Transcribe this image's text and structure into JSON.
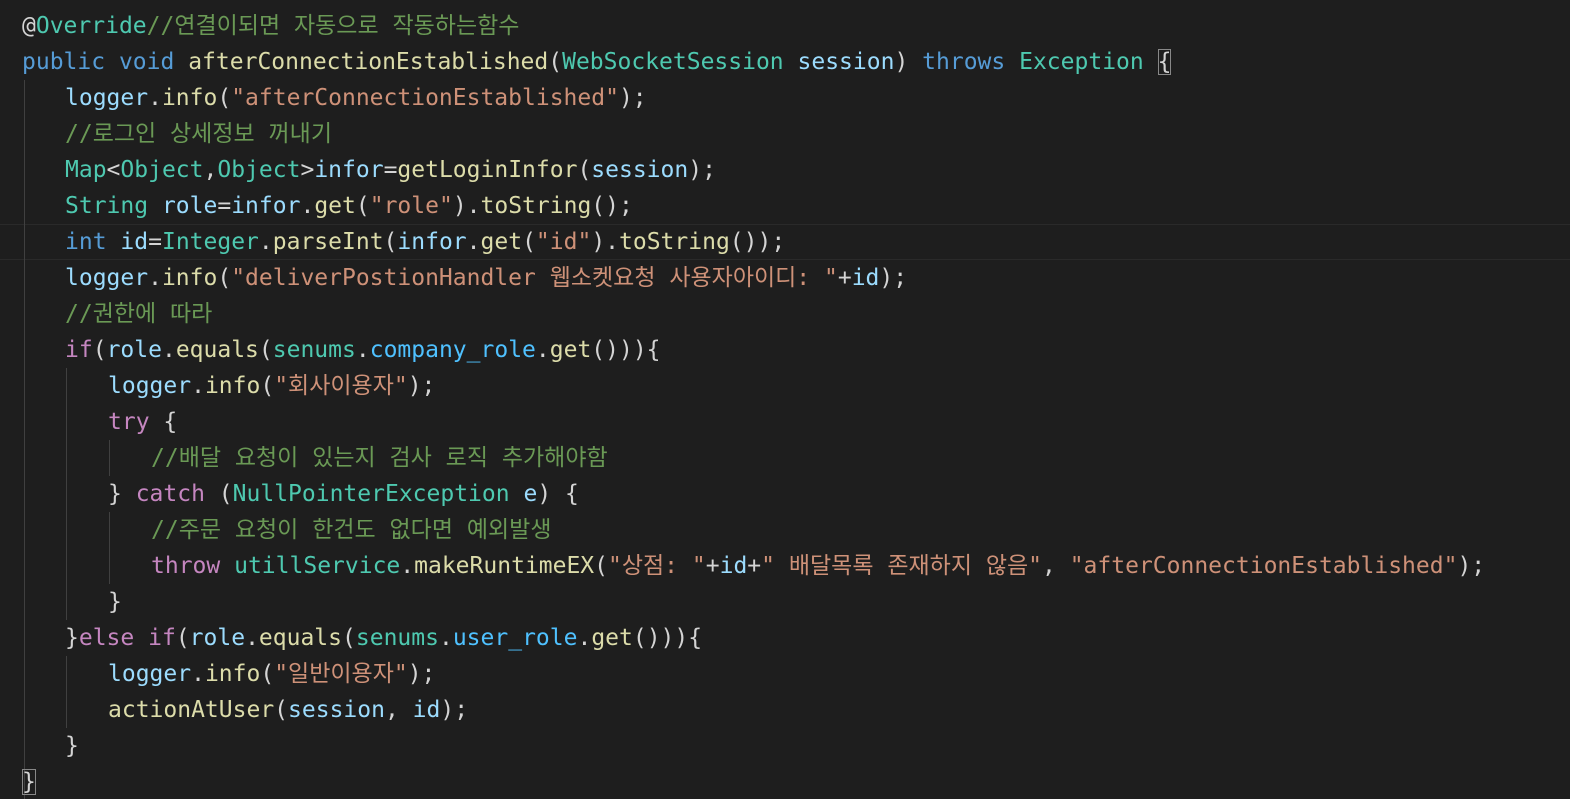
{
  "editor": {
    "language": "java",
    "theme": "dark",
    "colors": {
      "background": "#1e1e1e",
      "keyword": "#569cd6",
      "control": "#c586c0",
      "type": "#4ec9b0",
      "function": "#dcdcaa",
      "variable": "#9cdcfe",
      "string": "#ce9178",
      "comment": "#6a9955",
      "field": "#4fc1ff",
      "text": "#d4d4d4"
    },
    "lines": [
      [
        [
          "punc",
          "@"
        ],
        [
          "type",
          "Override"
        ],
        [
          "cmt",
          "//연결이되면 자동으로 작동하는함수"
        ]
      ],
      [
        [
          "kw",
          "public"
        ],
        [
          "punc",
          " "
        ],
        [
          "kw",
          "void"
        ],
        [
          "punc",
          " "
        ],
        [
          "fn",
          "afterConnectionEstablished"
        ],
        [
          "punc",
          "("
        ],
        [
          "type",
          "WebSocketSession"
        ],
        [
          "punc",
          " "
        ],
        [
          "var",
          "session"
        ],
        [
          "punc",
          ") "
        ],
        [
          "kw",
          "throws"
        ],
        [
          "punc",
          " "
        ],
        [
          "type",
          "Exception"
        ],
        [
          "punc",
          " "
        ],
        [
          "bracket",
          "{"
        ]
      ],
      [
        [
          "var",
          "logger"
        ],
        [
          "punc",
          "."
        ],
        [
          "fn",
          "info"
        ],
        [
          "punc",
          "("
        ],
        [
          "str",
          "\"afterConnectionEstablished\""
        ],
        [
          "punc",
          ");"
        ]
      ],
      [
        [
          "cmt",
          "//로그인 상세정보 꺼내기"
        ]
      ],
      [
        [
          "type",
          "Map"
        ],
        [
          "punc",
          "<"
        ],
        [
          "type",
          "Object"
        ],
        [
          "punc",
          ","
        ],
        [
          "type",
          "Object"
        ],
        [
          "punc",
          ">"
        ],
        [
          "var",
          "infor"
        ],
        [
          "punc",
          "="
        ],
        [
          "fn",
          "getLoginInfor"
        ],
        [
          "punc",
          "("
        ],
        [
          "var",
          "session"
        ],
        [
          "punc",
          ");"
        ]
      ],
      [
        [
          "type",
          "String"
        ],
        [
          "punc",
          " "
        ],
        [
          "var",
          "role"
        ],
        [
          "punc",
          "="
        ],
        [
          "var",
          "infor"
        ],
        [
          "punc",
          "."
        ],
        [
          "fn",
          "get"
        ],
        [
          "punc",
          "("
        ],
        [
          "str",
          "\"role\""
        ],
        [
          "punc",
          ")."
        ],
        [
          "fn",
          "toString"
        ],
        [
          "punc",
          "();"
        ]
      ],
      [
        [
          "kw",
          "int"
        ],
        [
          "punc",
          " "
        ],
        [
          "var",
          "id"
        ],
        [
          "punc",
          "="
        ],
        [
          "type",
          "Integer"
        ],
        [
          "punc",
          "."
        ],
        [
          "fn",
          "parseInt"
        ],
        [
          "punc",
          "("
        ],
        [
          "var",
          "infor"
        ],
        [
          "punc",
          "."
        ],
        [
          "fn",
          "get"
        ],
        [
          "punc",
          "("
        ],
        [
          "str",
          "\"id\""
        ],
        [
          "punc",
          ")."
        ],
        [
          "fn",
          "toString"
        ],
        [
          "punc",
          "());"
        ]
      ],
      [
        [
          "var",
          "logger"
        ],
        [
          "punc",
          "."
        ],
        [
          "fn",
          "info"
        ],
        [
          "punc",
          "("
        ],
        [
          "str",
          "\"deliverPostionHandler 웹소켓요청 사용자아이디: \""
        ],
        [
          "punc",
          "+"
        ],
        [
          "var",
          "id"
        ],
        [
          "punc",
          ");"
        ]
      ],
      [
        [
          "cmt",
          "//권한에 따라"
        ]
      ],
      [
        [
          "ctrl",
          "if"
        ],
        [
          "punc",
          "("
        ],
        [
          "var",
          "role"
        ],
        [
          "punc",
          "."
        ],
        [
          "fn",
          "equals"
        ],
        [
          "punc",
          "("
        ],
        [
          "type",
          "senums"
        ],
        [
          "punc",
          "."
        ],
        [
          "field",
          "company_role"
        ],
        [
          "punc",
          "."
        ],
        [
          "fn",
          "get"
        ],
        [
          "punc",
          "())){"
        ]
      ],
      [
        [
          "var",
          "logger"
        ],
        [
          "punc",
          "."
        ],
        [
          "fn",
          "info"
        ],
        [
          "punc",
          "("
        ],
        [
          "str",
          "\"회사이용자\""
        ],
        [
          "punc",
          ");"
        ]
      ],
      [
        [
          "ctrl",
          "try"
        ],
        [
          "punc",
          " {"
        ]
      ],
      [
        [
          "cmt",
          "//배달 요청이 있는지 검사 로직 추가해야함"
        ]
      ],
      [
        [
          "punc",
          "} "
        ],
        [
          "ctrl",
          "catch"
        ],
        [
          "punc",
          " ("
        ],
        [
          "type",
          "NullPointerException"
        ],
        [
          "punc",
          " "
        ],
        [
          "var",
          "e"
        ],
        [
          "punc",
          ") {"
        ]
      ],
      [
        [
          "cmt",
          "//주문 요청이 한건도 없다면 예외발생"
        ]
      ],
      [
        [
          "ctrl",
          "throw"
        ],
        [
          "punc",
          " "
        ],
        [
          "type",
          "utillService"
        ],
        [
          "punc",
          "."
        ],
        [
          "fn",
          "makeRuntimeEX"
        ],
        [
          "punc",
          "("
        ],
        [
          "str",
          "\"상점: \""
        ],
        [
          "punc",
          "+"
        ],
        [
          "var",
          "id"
        ],
        [
          "punc",
          "+"
        ],
        [
          "str",
          "\" 배달목록 존재하지 않음\""
        ],
        [
          "punc",
          ", "
        ],
        [
          "str",
          "\"afterConnectionEstablished\""
        ],
        [
          "punc",
          ");"
        ]
      ],
      [
        [
          "punc",
          "}"
        ]
      ],
      [
        [
          "punc",
          "}"
        ],
        [
          "ctrl",
          "else"
        ],
        [
          "punc",
          " "
        ],
        [
          "ctrl",
          "if"
        ],
        [
          "punc",
          "("
        ],
        [
          "var",
          "role"
        ],
        [
          "punc",
          "."
        ],
        [
          "fn",
          "equals"
        ],
        [
          "punc",
          "("
        ],
        [
          "type",
          "senums"
        ],
        [
          "punc",
          "."
        ],
        [
          "field",
          "user_role"
        ],
        [
          "punc",
          "."
        ],
        [
          "fn",
          "get"
        ],
        [
          "punc",
          "())){"
        ]
      ],
      [
        [
          "var",
          "logger"
        ],
        [
          "punc",
          "."
        ],
        [
          "fn",
          "info"
        ],
        [
          "punc",
          "("
        ],
        [
          "str",
          "\"일반이용자\""
        ],
        [
          "punc",
          ");"
        ]
      ],
      [
        [
          "fn",
          "actionAtUser"
        ],
        [
          "punc",
          "("
        ],
        [
          "var",
          "session"
        ],
        [
          "punc",
          ", "
        ],
        [
          "var",
          "id"
        ],
        [
          "punc",
          ");"
        ]
      ],
      [
        [
          "punc",
          "}"
        ]
      ],
      [
        [
          "bracket",
          "}"
        ]
      ]
    ]
  }
}
